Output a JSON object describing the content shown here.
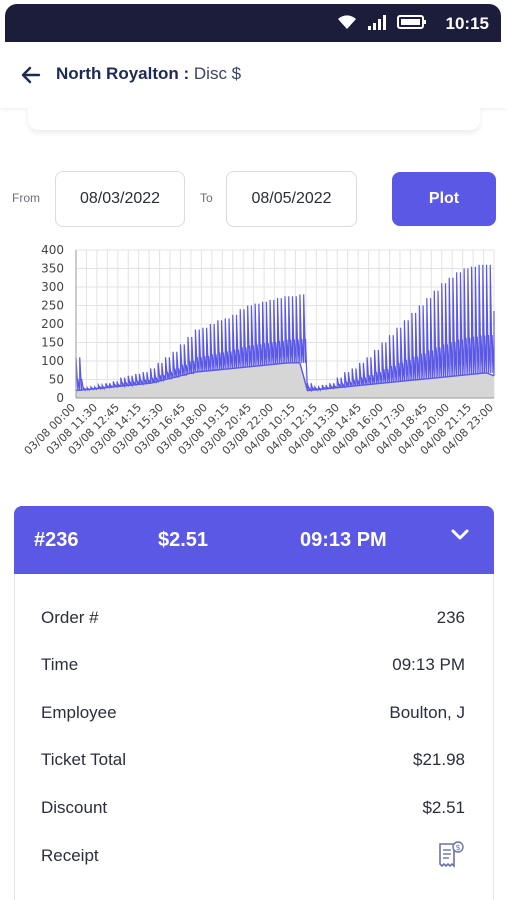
{
  "status_bar": {
    "time": "10:15",
    "icons": [
      "wifi-icon",
      "signal-icon",
      "battery-icon"
    ]
  },
  "header": {
    "location": "North Royalton",
    "separator": " : ",
    "metric": "Disc $"
  },
  "filters": {
    "from_label": "From",
    "from_date": "08/03/2022",
    "to_label": "To",
    "to_date": "08/05/2022",
    "plot_label": "Plot"
  },
  "chart_data": {
    "type": "area",
    "ylim": [
      0,
      400
    ],
    "yticks": [
      "0",
      "50",
      "100",
      "150",
      "200",
      "250",
      "300",
      "350",
      "400"
    ],
    "xticks": [
      "03/08 00:00",
      "03/08 11:30",
      "03/08 12:45",
      "03/08 14:15",
      "03/08 15:30",
      "03/08 16:45",
      "03/08 18:00",
      "03/08 19:15",
      "03/08 20:45",
      "03/08 22:00",
      "04/08 10:15",
      "04/08 12:15",
      "04/08 13:30",
      "04/08 14:45",
      "04/08 16:00",
      "04/08 17:30",
      "04/08 18:45",
      "04/08 20:00",
      "04/08 21:15",
      "04/08 23:00"
    ],
    "series": [
      {
        "values": [
          110,
          28,
          30,
          35,
          40,
          45,
          55,
          60,
          65,
          70,
          80,
          95,
          110,
          125,
          145,
          165,
          185,
          190,
          200,
          210,
          215,
          225,
          240,
          250,
          255,
          260,
          265,
          270,
          275,
          275,
          280,
          40,
          30,
          35,
          40,
          55,
          70,
          80,
          95,
          110,
          130,
          150,
          170,
          190,
          210,
          230,
          250,
          270,
          290,
          310,
          325,
          340,
          350,
          355,
          360,
          360,
          235
        ]
      },
      {
        "values": [
          20,
          22,
          24,
          26,
          28,
          30,
          32,
          34,
          36,
          38,
          40,
          45,
          50,
          55,
          60,
          65,
          70,
          72,
          74,
          76,
          78,
          80,
          82,
          84,
          86,
          88,
          90,
          92,
          94,
          95,
          95,
          20,
          22,
          24,
          26,
          28,
          30,
          32,
          34,
          36,
          38,
          40,
          42,
          44,
          46,
          48,
          50,
          52,
          54,
          56,
          58,
          60,
          62,
          64,
          66,
          68,
          60
        ]
      }
    ],
    "grid": true,
    "colors": {
      "line": "#5b58e6",
      "fill": "#d6d6d6",
      "grid": "#e3e3e3"
    }
  },
  "order": {
    "number": "#236",
    "amount": "$2.51",
    "time": "09:13 PM",
    "rows": [
      {
        "label": "Order #",
        "value": "236"
      },
      {
        "label": "Time",
        "value": "09:13 PM"
      },
      {
        "label": "Employee",
        "value": "Boulton, J"
      },
      {
        "label": "Ticket Total",
        "value": "$21.98"
      },
      {
        "label": "Discount",
        "value": "$2.51"
      },
      {
        "label": "Receipt",
        "value": ""
      }
    ],
    "receipt_icon": "receipt-icon"
  },
  "colors": {
    "accent": "#5b58e6",
    "status_bar": "#1c1d3a"
  }
}
